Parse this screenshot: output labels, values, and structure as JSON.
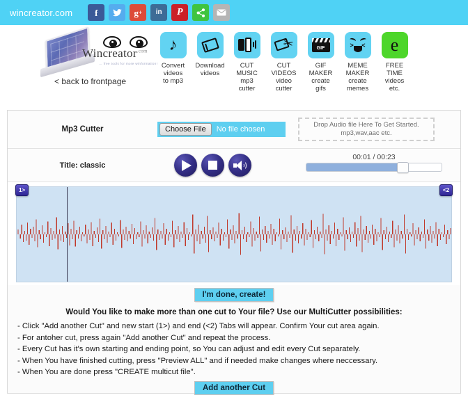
{
  "topbar": {
    "site_name": "wincreator.com",
    "social": [
      {
        "name": "facebook-share-button",
        "glyph": "f",
        "color": "#3b5998"
      },
      {
        "name": "twitter-share-button",
        "glyph": "✒",
        "color": "#55acee"
      },
      {
        "name": "google-plus-share-button",
        "glyph": "g+",
        "color": "#dd4b39"
      },
      {
        "name": "linkedin-share-button",
        "glyph": "in",
        "color": "#3d6c96"
      },
      {
        "name": "pinterest-share-button",
        "glyph": "P",
        "color": "#cb2027"
      },
      {
        "name": "share-button",
        "glyph": "‹",
        "color": "#3fc43f"
      },
      {
        "name": "email-share-button",
        "glyph": "✉",
        "color": "#b5b5b5"
      }
    ]
  },
  "brand": {
    "wordmark": "Wincreator",
    "wordmark_suffix": ".com",
    "tagline": "... free tools for more winformation!",
    "back_link": "< back to frontpage"
  },
  "iconmenu": [
    {
      "icon": "music-note-icon",
      "label": "Convert\nvideos\nto mp3",
      "lines": [
        "Convert",
        "videos",
        "to mp3"
      ]
    },
    {
      "icon": "film-frame-icon",
      "label": "Download videos",
      "lines": [
        "Download",
        "videos"
      ]
    },
    {
      "icon": "phones-audio-icon",
      "label": "CUT MUSIC mp3 cutter",
      "lines": [
        "CUT",
        "MUSIC",
        "mp3",
        "cutter"
      ]
    },
    {
      "icon": "film-scissors-icon",
      "label": "CUT VIDEOS video cutter",
      "lines": [
        "CUT",
        "VIDEOS",
        "video",
        "cutter"
      ]
    },
    {
      "icon": "gif-clapper-icon",
      "label": "GIF MAKER create gifs",
      "lines": [
        "GIF",
        "MAKER",
        "create",
        "gifs"
      ]
    },
    {
      "icon": "meme-face-icon",
      "label": "MEME MAKER create memes",
      "lines": [
        "MEME",
        "MAKER",
        "create",
        "memes"
      ]
    },
    {
      "icon": "letter-e-icon",
      "label": "FREE TIME videos etc.",
      "lines": [
        "FREE",
        "TIME",
        "videos",
        "etc."
      ]
    }
  ],
  "tool": {
    "name": "Mp3 Cutter",
    "choose_file_label": "Choose File",
    "no_file_text": "No file chosen",
    "dropzone_line1": "Drop Audio file Here To Get Started.",
    "dropzone_line2": "mp3,wav,aac etc."
  },
  "player": {
    "title": "Title: classic",
    "play_button": "play-button",
    "stop_button": "stop-button",
    "volume_button": "volume-button",
    "time_display": "00:01 / 00:23",
    "current_time": "00:01",
    "total_time": "00:23",
    "progress_percent": 71
  },
  "waveform": {
    "start_tab": "1>",
    "end_tab": "<2",
    "wave_color": "#c0392b",
    "selection_color": "#cfe2f3"
  },
  "actions": {
    "done_button": "I'm done, create!",
    "add_cut_button": "Add another Cut"
  },
  "instructions": {
    "heading": "Would You like to make more than one cut to Your file? Use our MultiCutter possibilities:",
    "lines": [
      "- Click \"Add another Cut\" and new start (1>) and end (<2) Tabs will appear. Confirm Your cut area again.",
      "- For antoher cut, press again \"Add another Cut\" and repeat the process.",
      "- Every Cut has it's own starting and ending point, so You can adjust and edit every Cut separately.",
      "- When You have finished cutting, press \"Preview ALL\" and if needed make changes where neccessary.",
      "- When You are done press \"CREATE multicut file\"."
    ]
  },
  "colors": {
    "brand_cyan": "#4fd2f5",
    "button_cyan": "#5ecff0",
    "wave_bg": "#cfe2f3",
    "wave_red": "#c0392b",
    "control_dark": "#2f2986"
  }
}
